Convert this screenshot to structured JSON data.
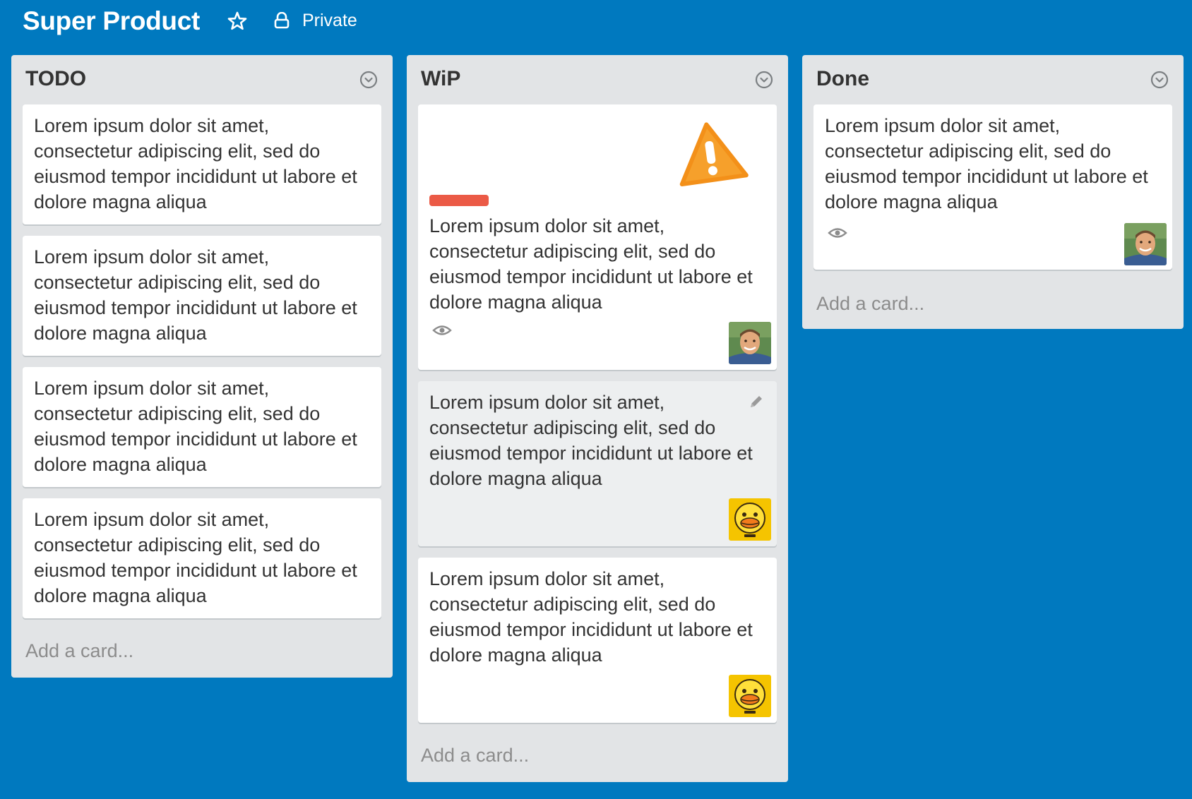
{
  "header": {
    "title": "Super Product",
    "privacy_label": "Private"
  },
  "lists": [
    {
      "title": "TODO",
      "cards": [
        "Lorem ipsum dolor sit amet, consectetur adipiscing elit, sed do eiusmod tempor incididunt ut labore et dolore magna aliqua",
        "Lorem ipsum dolor sit amet, consectetur adipiscing elit, sed do eiusmod tempor incididunt ut labore et dolore magna aliqua",
        "Lorem ipsum dolor sit amet, consectetur adipiscing elit, sed do eiusmod tempor incididunt ut labore et dolore magna aliqua",
        "Lorem ipsum dolor sit amet, consectetur adipiscing elit, sed do eiusmod tempor incididunt ut labore et dolore magna aliqua"
      ],
      "add_card": "Add a card..."
    },
    {
      "title": "WiP",
      "cards": [
        "Lorem ipsum dolor sit amet, consectetur adipiscing elit, sed do eiusmod tempor incididunt ut labore et dolore magna aliqua",
        "Lorem ipsum dolor sit amet, consectetur adipiscing elit, sed do eiusmod tempor incididunt ut labore et dolore magna aliqua",
        "Lorem ipsum dolor sit amet, consectetur adipiscing elit, sed do eiusmod tempor incididunt ut labore et dolore magna aliqua"
      ],
      "add_card": "Add a card..."
    },
    {
      "title": "Done",
      "cards": [
        "Lorem ipsum dolor sit amet, consectetur adipiscing elit, sed do eiusmod tempor incididunt ut labore et dolore magna aliqua"
      ],
      "add_card": "Add a card..."
    }
  ],
  "icons": {
    "star": "star-outline-icon",
    "privacy": "lock-icon",
    "list_menu": "chevron-circle-icon",
    "watch": "eye-icon",
    "edit": "pencil-icon",
    "warning": "warning-sticker",
    "avatar_person": "person-avatar",
    "avatar_duck": "duck-avatar"
  },
  "colors": {
    "board_background": "#0079bf",
    "list_background": "#e2e4e6",
    "card_background": "#ffffff",
    "label_red": "#eb5a46",
    "text": "#333333",
    "muted_text": "#8c8c8c"
  }
}
